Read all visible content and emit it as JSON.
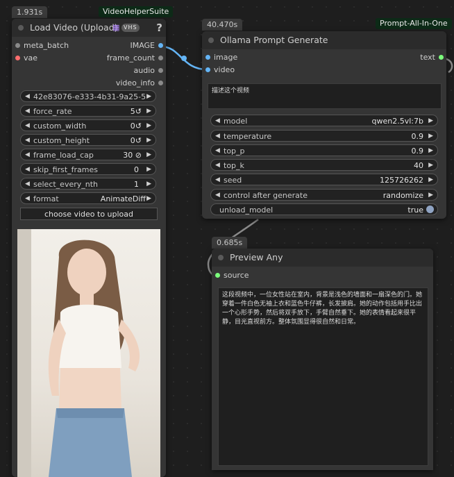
{
  "load_video": {
    "timing": "1.931s",
    "group_badge": "VideoHelperSuite",
    "title": "Load Video (Upload)",
    "help": "?",
    "vhs_badge": "VHS",
    "inputs": [
      "meta_batch",
      "vae"
    ],
    "outputs": [
      "IMAGE",
      "frame_count",
      "audio",
      "video_info"
    ],
    "widgets": [
      {
        "label": "",
        "value": "42e83076-e333-4b31-9a25-5 ..."
      },
      {
        "label": "force_rate",
        "value": "5",
        "icon": "↺"
      },
      {
        "label": "custom_width",
        "value": "0",
        "icon": "↺"
      },
      {
        "label": "custom_height",
        "value": "0",
        "icon": "↺"
      },
      {
        "label": "frame_load_cap",
        "value": "30",
        "icon": "⊘"
      },
      {
        "label": "skip_first_frames",
        "value": "0",
        "icon": ""
      },
      {
        "label": "select_every_nth",
        "value": "1",
        "icon": ""
      },
      {
        "label": "format",
        "value": "AnimateDiff",
        "icon": ""
      }
    ],
    "upload_button": "choose video to upload"
  },
  "ollama": {
    "timing": "40.470s",
    "group_badge": "Prompt-All-In-One",
    "title": "Ollama Prompt Generate",
    "inputs": [
      "image",
      "video"
    ],
    "outputs": [
      "text"
    ],
    "prompt_text": "描述这个视频",
    "widgets": [
      {
        "label": "model",
        "value": "qwen2.5vl:7b"
      },
      {
        "label": "temperature",
        "value": "0.9"
      },
      {
        "label": "top_p",
        "value": "0.9"
      },
      {
        "label": "top_k",
        "value": "40"
      },
      {
        "label": "seed",
        "value": "125726262"
      },
      {
        "label": "control after generate",
        "value": "randomize"
      }
    ],
    "toggle": {
      "label": "unload_model",
      "value": "true"
    }
  },
  "preview": {
    "timing": "0.685s",
    "title": "Preview Any",
    "inputs": [
      "source"
    ],
    "output_text": "这段视频中，一位女性站在室内，背景是浅色的墙面和一扇深色的门。她穿着一件白色无袖上衣和蓝色牛仔裤，长发披肩。她的动作包括用手比出一个心形手势，然后将双手放下，手臂自然垂下。她的表情看起来很平静，目光直视前方。整体氛围显得很自然和日常。"
  },
  "colors": {
    "canvas": "#1e1e1e",
    "node_body": "#353535",
    "node_title": "#2b2b2b",
    "image_slot": "#64b5f6",
    "vae_slot": "#ff6e6e",
    "string_slot": "#7cff7c",
    "link": "#64b5f6"
  }
}
